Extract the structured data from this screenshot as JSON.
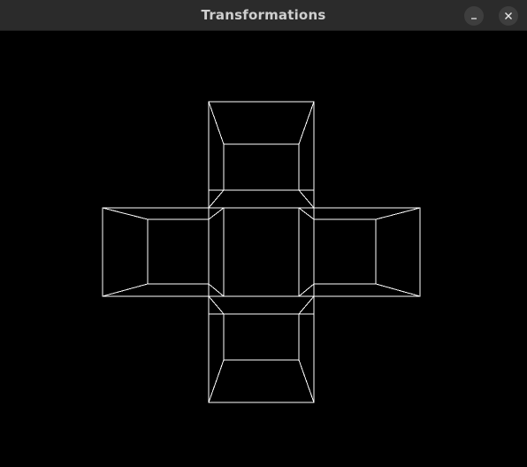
{
  "window": {
    "title": "Transformations",
    "buttons": {
      "minimize_icon": "minimize-icon",
      "close_icon": "close-icon"
    }
  },
  "scene": {
    "background_color": "#000000",
    "line_color": "#ffffff",
    "description_free": true,
    "shapes": [
      {
        "name": "cube-top"
      },
      {
        "name": "cube-left"
      },
      {
        "name": "cube-right"
      },
      {
        "name": "cube-bottom"
      }
    ]
  }
}
